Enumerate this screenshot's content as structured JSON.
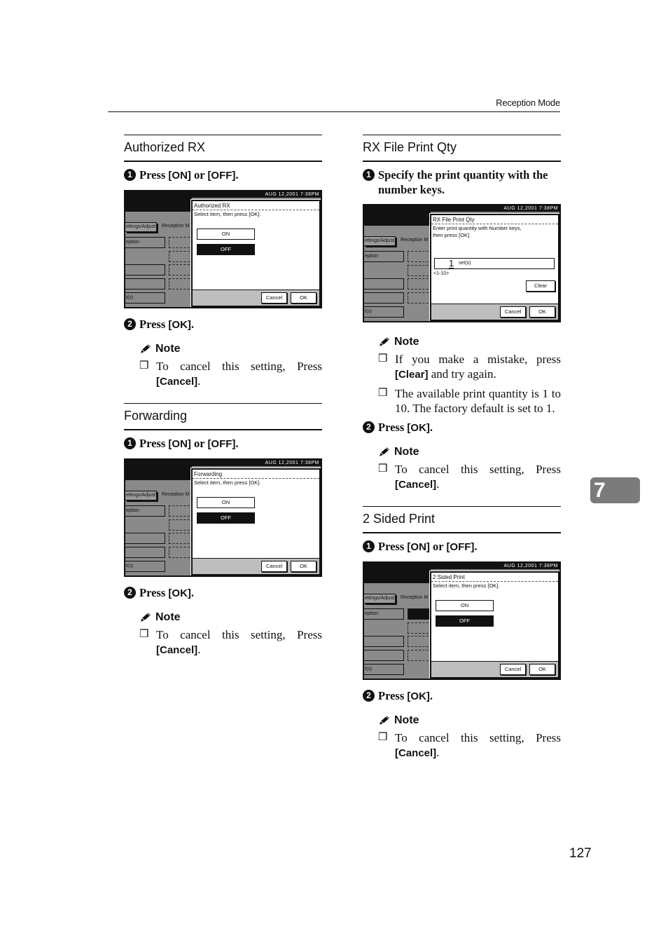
{
  "running_head": "Reception Mode",
  "chapter_tab": "7",
  "page_number": "127",
  "screen_common": {
    "status_time": "AUG  12,2001  7:38PM",
    "tab_settings": "ettings/Adjust",
    "tab_reception": "Reception M",
    "field_reception": "eption",
    "field_sets": "t(s)",
    "cancel_label": "Cancel",
    "ok_label": "OK",
    "on_label": "ON",
    "off_label": "OFF"
  },
  "sections": {
    "authorized_rx": {
      "title": "Authorized RX",
      "step1": {
        "num": "1",
        "text_pre": "Press ",
        "key1": "[ON]",
        "text_mid": " or ",
        "key2": "[OFF]",
        "text_post": "."
      },
      "screen": {
        "dialog_title": "Authorized RX",
        "dialog_msg": "Select item, then press [OK].",
        "selected": "OFF"
      },
      "step2": {
        "num": "2",
        "text_pre": "Press ",
        "key": "[OK]",
        "text_post": "."
      },
      "note": {
        "heading": "Note",
        "items": [
          {
            "text": "To cancel this setting, Press ",
            "key": "[Cancel]",
            "post": "."
          }
        ]
      }
    },
    "forwarding": {
      "title": "Forwarding",
      "step1": {
        "num": "1",
        "text_pre": "Press ",
        "key1": "[ON]",
        "text_mid": " or ",
        "key2": "[OFF]",
        "text_post": "."
      },
      "screen": {
        "dialog_title": "Forwarding",
        "dialog_msg": "Select item, then press [OK].",
        "selected": "OFF"
      },
      "step2": {
        "num": "2",
        "text_pre": "Press ",
        "key": "[OK]",
        "text_post": "."
      },
      "note": {
        "heading": "Note",
        "items": [
          {
            "text": "To cancel this setting, Press ",
            "key": "[Cancel]",
            "post": "."
          }
        ]
      }
    },
    "rx_file_print_qty": {
      "title": "RX File Print Qty",
      "step1": {
        "num": "1",
        "text": "Specify the print quantity with the number keys."
      },
      "screen": {
        "dialog_title": "RX File Print Qty",
        "dialog_msg_line1": "Enter print quantity with Number keys,",
        "dialog_msg_line2": "then press [OK].",
        "qty_value": "1",
        "qty_unit": "set(s)",
        "range": "<1-10>",
        "clear_label": "Clear"
      },
      "note1": {
        "heading": "Note",
        "item1": {
          "pre": "If you make a mistake, press ",
          "key": "[Clear]",
          "post": " and try again."
        },
        "item2": {
          "text": "The available print quantity is 1 to 10. The factory default is set to 1."
        }
      },
      "step2": {
        "num": "2",
        "text_pre": "Press ",
        "key": "[OK]",
        "text_post": "."
      },
      "note2": {
        "heading": "Note",
        "items": [
          {
            "text": "To cancel this setting, Press ",
            "key": "[Cancel]",
            "post": "."
          }
        ]
      }
    },
    "two_sided_print": {
      "title": "2 Sided Print",
      "step1": {
        "num": "1",
        "text_pre": "Press ",
        "key1": "[ON]",
        "text_mid": " or ",
        "key2": "[OFF]",
        "text_post": "."
      },
      "screen": {
        "dialog_title": "2 Sided Print",
        "dialog_msg": "Select item, then press [OK].",
        "selected": "OFF"
      },
      "step2": {
        "num": "2",
        "text_pre": "Press ",
        "key": "[OK]",
        "text_post": "."
      },
      "note": {
        "heading": "Note",
        "items": [
          {
            "text": "To cancel this setting, Press ",
            "key": "[Cancel]",
            "post": "."
          }
        ]
      }
    }
  }
}
